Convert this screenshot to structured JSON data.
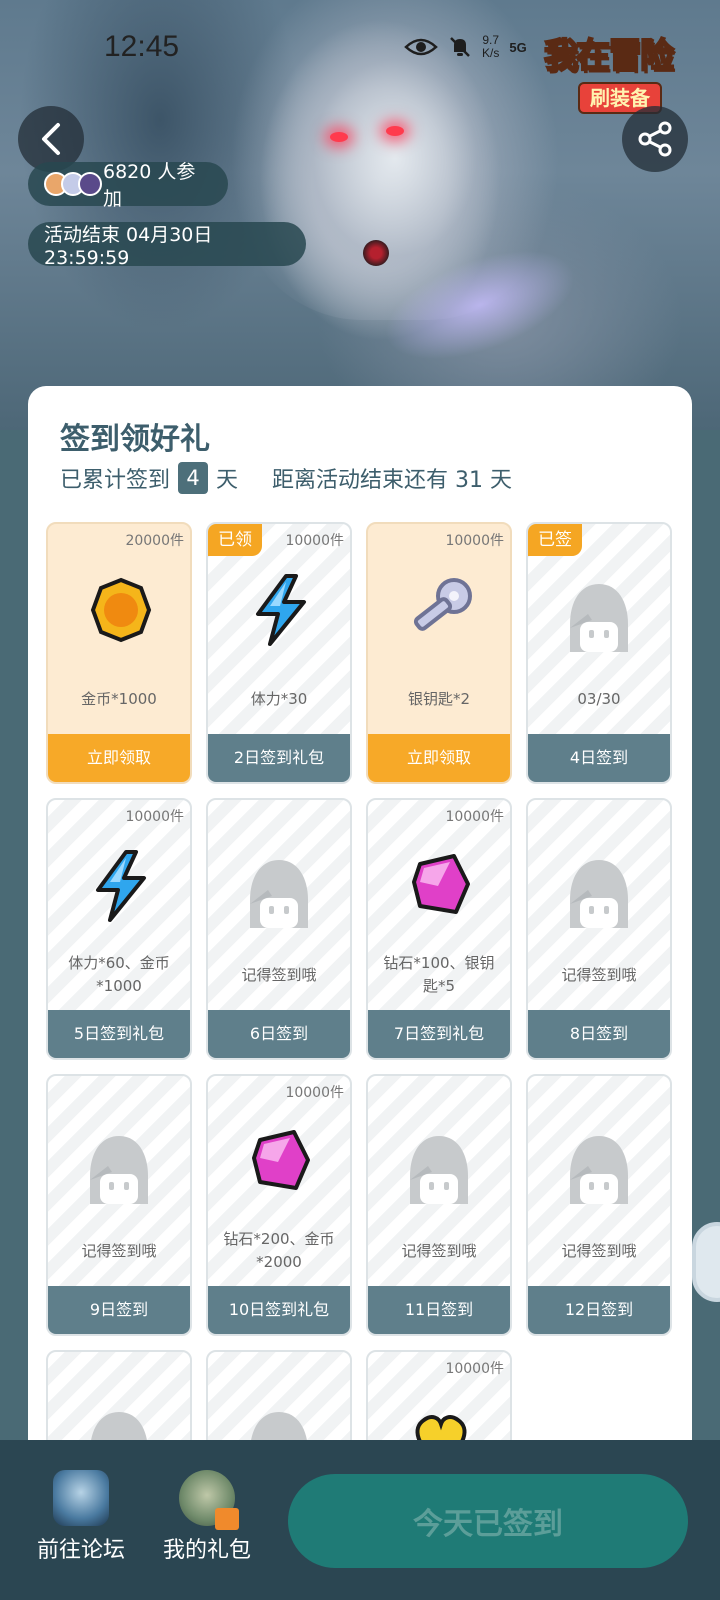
{
  "status_bar": {
    "time": "12:45",
    "speed_value": "9.7",
    "speed_unit": "K/s",
    "network": "5G",
    "icons": [
      "eye-icon",
      "mute-bell-icon"
    ]
  },
  "logo": {
    "title": "我在冒险",
    "subtitle": "刷装备"
  },
  "hero": {
    "participants": "6820 人参加",
    "end_time": "活动结束 04月30日 23:59:59"
  },
  "card": {
    "title": "签到领好礼",
    "sub_prefix": "已累计签到",
    "days_count": "4",
    "sub_days_unit": "天",
    "sub_remaining": "距离活动结束还有 31 天"
  },
  "tiles": [
    {
      "count": "20000件",
      "tag": "",
      "icon": "gold-coin-icon",
      "desc": "金币*1000",
      "foot": "立即领取",
      "state": "claim"
    },
    {
      "count": "10000件",
      "tag": "已领",
      "icon": "lightning-icon",
      "desc": "体力*30",
      "foot": "2日签到礼包",
      "state": "done"
    },
    {
      "count": "10000件",
      "tag": "",
      "icon": "silver-key-icon",
      "desc": "银钥匙*2",
      "foot": "立即领取",
      "state": "claim"
    },
    {
      "count": "",
      "tag": "已签",
      "icon": "hooded-ghost-icon",
      "desc": "03/30",
      "foot": "4日签到",
      "state": "done"
    },
    {
      "count": "10000件",
      "tag": "",
      "icon": "lightning-icon",
      "desc": "体力*60、金币*1000",
      "foot": "5日签到礼包",
      "state": "locked"
    },
    {
      "count": "",
      "tag": "",
      "icon": "hooded-ghost-icon",
      "desc": "记得签到哦",
      "foot": "6日签到",
      "state": "locked"
    },
    {
      "count": "10000件",
      "tag": "",
      "icon": "diamond-icon",
      "desc": "钻石*100、银钥匙*5",
      "foot": "7日签到礼包",
      "state": "locked"
    },
    {
      "count": "",
      "tag": "",
      "icon": "hooded-ghost-icon",
      "desc": "记得签到哦",
      "foot": "8日签到",
      "state": "locked"
    },
    {
      "count": "",
      "tag": "",
      "icon": "hooded-ghost-icon",
      "desc": "记得签到哦",
      "foot": "9日签到",
      "state": "locked"
    },
    {
      "count": "10000件",
      "tag": "",
      "icon": "diamond-icon",
      "desc": "钻石*200、金币*2000",
      "foot": "10日签到礼包",
      "state": "locked"
    },
    {
      "count": "",
      "tag": "",
      "icon": "hooded-ghost-icon",
      "desc": "记得签到哦",
      "foot": "11日签到",
      "state": "locked"
    },
    {
      "count": "",
      "tag": "",
      "icon": "hooded-ghost-icon",
      "desc": "记得签到哦",
      "foot": "12日签到",
      "state": "locked"
    },
    {
      "count": "",
      "tag": "",
      "icon": "hooded-ghost-icon",
      "desc": "",
      "foot": "",
      "state": "locked"
    },
    {
      "count": "",
      "tag": "",
      "icon": "hooded-ghost-icon",
      "desc": "",
      "foot": "",
      "state": "locked"
    },
    {
      "count": "10000件",
      "tag": "",
      "icon": "gold-heart-icon",
      "desc": "",
      "foot": "",
      "state": "locked"
    }
  ],
  "bottom": {
    "forum_label": "前往论坛",
    "gift_label": "我的礼包",
    "checkin_label": "今天已签到"
  },
  "colors": {
    "accent": "#f7a928",
    "teal": "#1f7b76",
    "slate": "#5f7f8b",
    "title": "#3d5e6c"
  }
}
